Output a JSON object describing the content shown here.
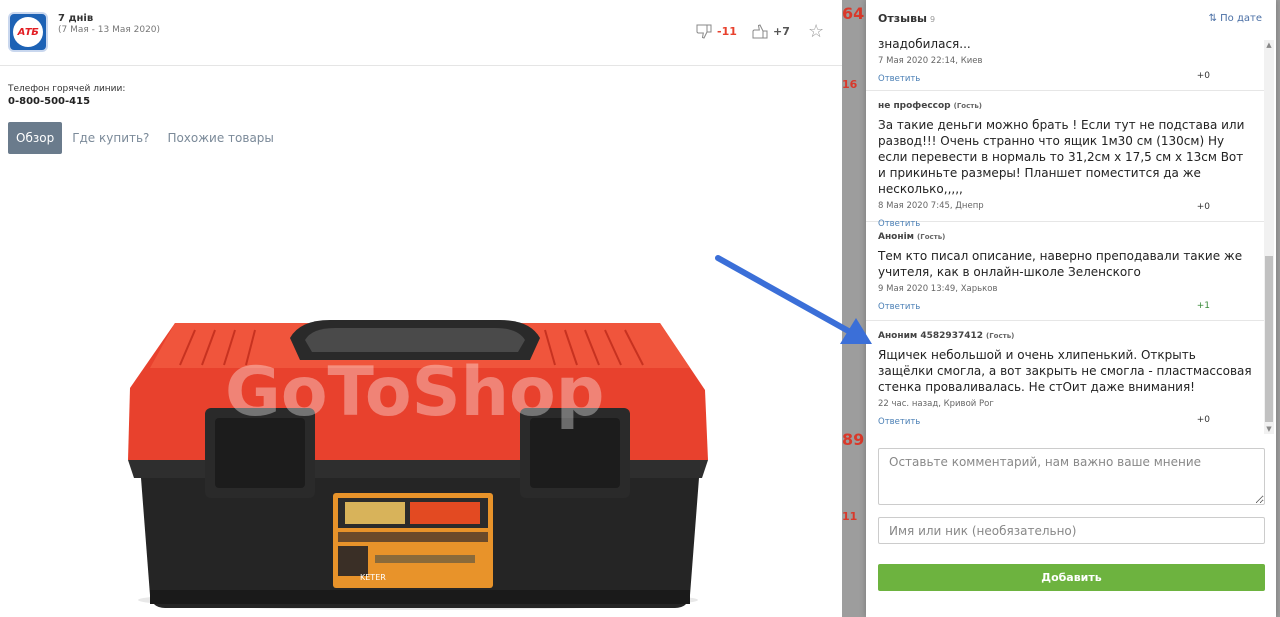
{
  "store": {
    "logo_text": "АТБ",
    "title": "7 днів",
    "dates": "(7 Мая - 13 Мая 2020)"
  },
  "votes": {
    "down": "-11",
    "up": "+7"
  },
  "hotline": {
    "label": "Телефон горячей линии:",
    "number": "0-800-500-415"
  },
  "tabs": [
    {
      "label": "Обзор",
      "active": true
    },
    {
      "label": "Где купить?"
    },
    {
      "label": "Похожие товары"
    }
  ],
  "product": {
    "watermark": "GoToShop",
    "brand": "KETER",
    "label_colors": [
      "#e8932a",
      "#2b2b2b",
      "#e34a22"
    ]
  },
  "reviews_panel": {
    "title": "Отзывы",
    "count": "9",
    "sort_label": "По дате",
    "reply_label": "Ответить",
    "guest_label": "(Гость)",
    "reviews": [
      {
        "author": "",
        "guest": "",
        "text": "знадобилася...",
        "meta": "7 Мая 2020 22:14, Киев",
        "score": "+0"
      },
      {
        "author": "не профессор",
        "guest": "(Гость)",
        "text": "За такие деньги можно брать ! Если тут не подстава или развод!!! Очень странно что ящик 1м30 см (130см) Ну если перевести в нормаль то 31,2см х 17,5 см х 13см Вот и прикиньте размеры! Планшет поместится да же несколько,,,,,",
        "meta": "8 Мая 2020 7:45, Днепр",
        "score": "+0"
      },
      {
        "author": "Анонім",
        "guest": "(Гость)",
        "text": "Тем кто писал описание, наверно преподавали такие же учителя, как в онлайн-школе Зеленского",
        "meta": "9 Мая 2020 13:49, Харьков",
        "score": "+1"
      },
      {
        "author": "Аноним 4582937412",
        "guest": "(Гость)",
        "text": "Ящичек небольшой и очень хлипенький. Открыть защёлки смогла, а вот закрыть не смогла - пластмассовая стенка проваливалась. Не стОит даже внимания!",
        "meta": "22 час. назад, Кривой Рог",
        "score": "+0"
      }
    ],
    "comment_placeholder": "Оставьте комментарий, нам важно ваше мнение",
    "name_placeholder": "Имя или ник (необязательно)",
    "submit_label": "Добавить"
  },
  "backdrop_fragments": [
    "64",
    "16",
    "89",
    "11"
  ],
  "colors": {
    "accent_green": "#6db33f",
    "link_blue": "#4a7fb5",
    "arrow_blue": "#3b6fd8",
    "box_red": "#e8412d"
  }
}
